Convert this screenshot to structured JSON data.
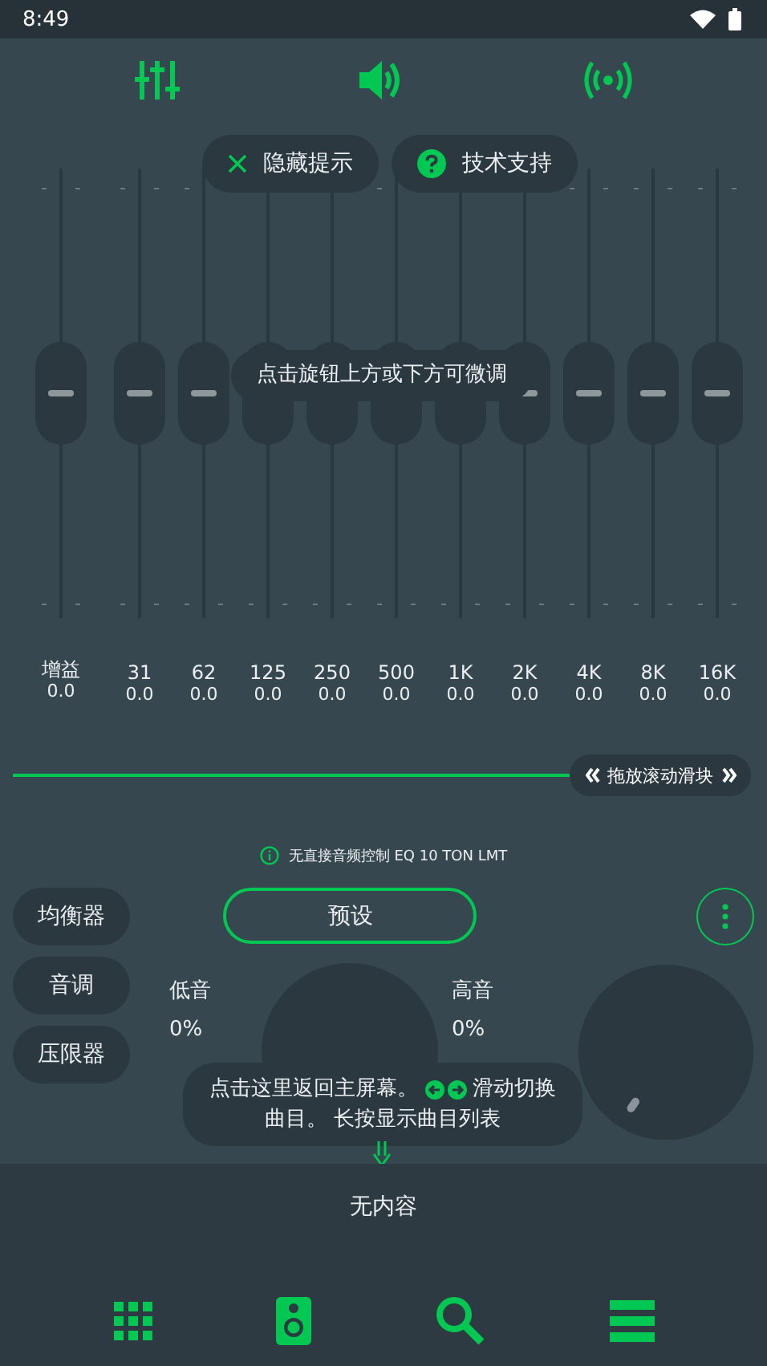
{
  "status_bar": {
    "time": "8:49"
  },
  "hint_buttons": [
    {
      "kind": "close",
      "label": "隐藏提示"
    },
    {
      "kind": "help",
      "label": "技术支持"
    }
  ],
  "equalizer": {
    "fine_tune_hint": "点击旋钮上方或下方可微调",
    "bands": [
      {
        "label": "增益",
        "value": "0.0",
        "level": 0.5
      },
      {
        "label": "31",
        "value": "0.0",
        "level": 0.5
      },
      {
        "label": "62",
        "value": "0.0",
        "level": 0.5
      },
      {
        "label": "125",
        "value": "0.0",
        "level": 0.5
      },
      {
        "label": "250",
        "value": "0.0",
        "level": 0.5
      },
      {
        "label": "500",
        "value": "0.0",
        "level": 0.5
      },
      {
        "label": "1K",
        "value": "0.0",
        "level": 0.5
      },
      {
        "label": "2K",
        "value": "0.0",
        "level": 0.5
      },
      {
        "label": "4K",
        "value": "0.0",
        "level": 0.5
      },
      {
        "label": "8K",
        "value": "0.0",
        "level": 0.5
      },
      {
        "label": "16K",
        "value": "0.0",
        "level": 0.5
      }
    ]
  },
  "scroll_slider": {
    "label": "拖放滚动滑块",
    "level": 1
  },
  "info": "无直接音频控制 EQ 10 TON LMT",
  "side_tabs": [
    {
      "label": "均衡器"
    },
    {
      "label": "音调"
    },
    {
      "label": "压限器"
    }
  ],
  "preset_button": "预设",
  "tone": {
    "bass": {
      "label": "低音",
      "value": "0%"
    },
    "treble": {
      "label": "高音",
      "value": "0%"
    }
  },
  "player_hint": {
    "line_1_start": "点击这里返回主屏幕。",
    "line_1_end": "滑动切换",
    "line_2": "曲目。 长按显示曲目列表"
  },
  "queue": {
    "empty_text": "无内容"
  }
}
